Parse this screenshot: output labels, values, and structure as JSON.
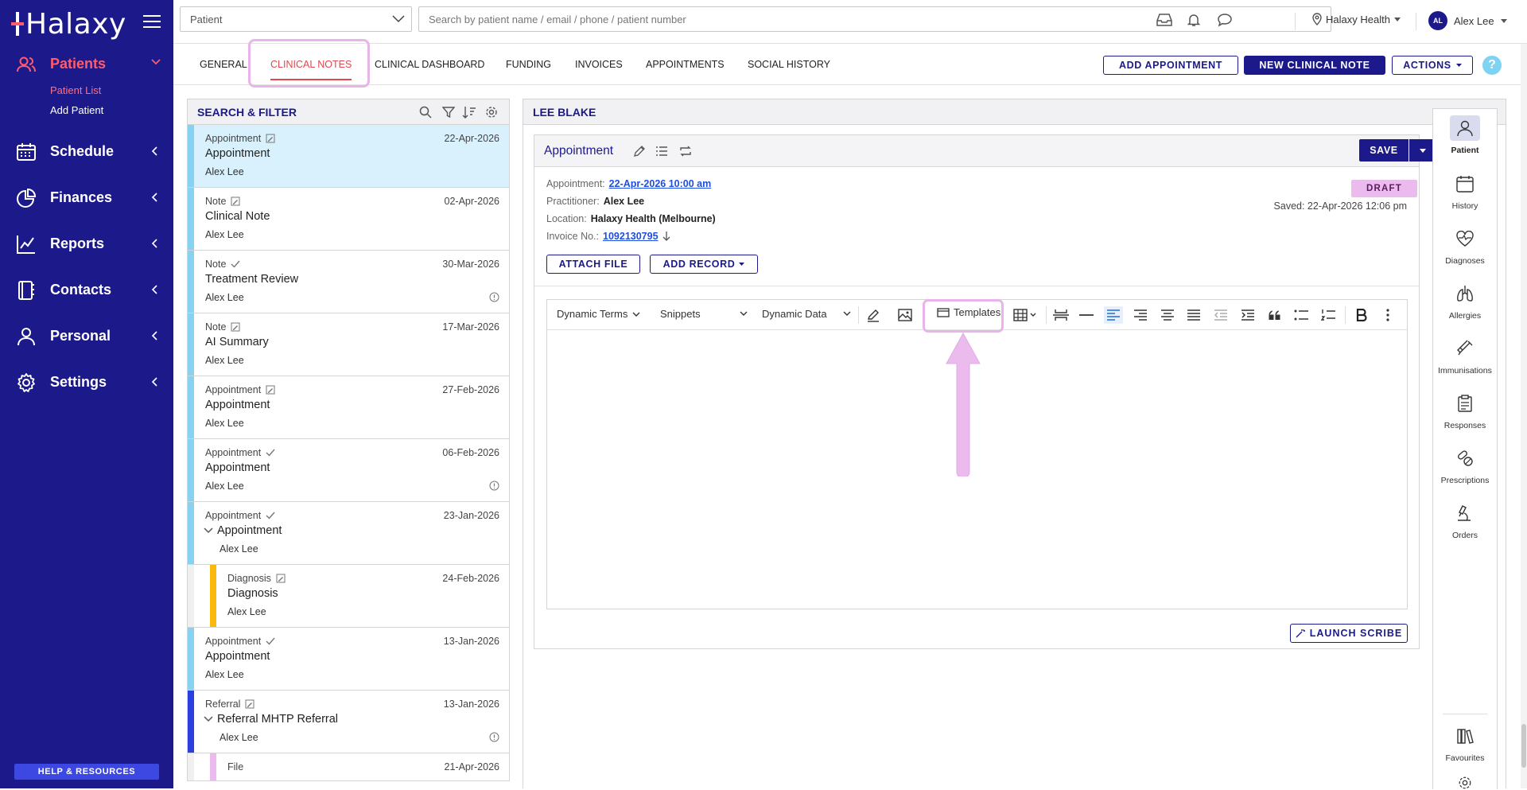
{
  "app": {
    "brand": "Halaxy",
    "accent": "#1c1a8a",
    "highlight": "#e0484e"
  },
  "sidebar": {
    "items": [
      {
        "label": "Patients",
        "icon": "users-icon"
      },
      {
        "label": "Schedule",
        "icon": "calendar-icon"
      },
      {
        "label": "Finances",
        "icon": "pie-chart-icon"
      },
      {
        "label": "Reports",
        "icon": "line-chart-icon"
      },
      {
        "label": "Contacts",
        "icon": "contacts-book-icon"
      },
      {
        "label": "Personal",
        "icon": "person-icon"
      },
      {
        "label": "Settings",
        "icon": "gear-icon"
      }
    ],
    "patient_sub": {
      "list": "Patient List",
      "add": "Add Patient"
    },
    "help": "HELP & RESOURCES"
  },
  "topbar": {
    "patient_select": "Patient",
    "search_placeholder": "Search by patient name / email / phone / patient number",
    "location": "Halaxy Health",
    "user_initials": "AL",
    "user_name": "Alex Lee"
  },
  "tabs": [
    "GENERAL",
    "CLINICAL NOTES",
    "CLINICAL DASHBOARD",
    "FUNDING",
    "INVOICES",
    "APPOINTMENTS",
    "SOCIAL HISTORY"
  ],
  "actions": {
    "add_appointment": "ADD APPOINTMENT",
    "new_clinical_note": "NEW CLINICAL NOTE",
    "actions": "ACTIONS",
    "help": "?"
  },
  "list": {
    "title": "SEARCH & FILTER",
    "notes": [
      {
        "type": "Appointment",
        "date": "22-Apr-2026",
        "title": "Appointment",
        "author": "Alex Lee"
      },
      {
        "type": "Note",
        "date": "02-Apr-2026",
        "title": "Clinical Note",
        "author": "Alex Lee"
      },
      {
        "type": "Note",
        "date": "30-Mar-2026",
        "title": "Treatment Review",
        "author": "Alex Lee"
      },
      {
        "type": "Note",
        "date": "17-Mar-2026",
        "title": "AI Summary",
        "author": "Alex Lee"
      },
      {
        "type": "Appointment",
        "date": "27-Feb-2026",
        "title": "Appointment",
        "author": "Alex Lee"
      },
      {
        "type": "Appointment",
        "date": "06-Feb-2026",
        "title": "Appointment",
        "author": "Alex Lee"
      },
      {
        "type": "Appointment",
        "date": "23-Jan-2026",
        "title": "Appointment",
        "author": "Alex Lee"
      },
      {
        "type": "Diagnosis",
        "date": "24-Feb-2026",
        "title": "Diagnosis",
        "author": "Alex Lee"
      },
      {
        "type": "Appointment",
        "date": "13-Jan-2026",
        "title": "Appointment",
        "author": "Alex Lee"
      },
      {
        "type": "Referral",
        "date": "13-Jan-2026",
        "title": "Referral MHTP Referral",
        "author": "Alex Lee"
      },
      {
        "type": "File",
        "date": "21-Apr-2026",
        "title": "",
        "author": ""
      }
    ]
  },
  "detail": {
    "patient_name": "LEE BLAKE",
    "card_title": "Appointment",
    "save": "SAVE",
    "status": "DRAFT",
    "saved": "Saved: 22-Apr-2026 12:06 pm",
    "appointment_label": "Appointment:",
    "appointment_value": "22-Apr-2026 10:00 am",
    "practitioner_label": "Practitioner:",
    "practitioner_value": "Alex Lee",
    "location_label": "Location:",
    "location_value": "Halaxy Health (Melbourne)",
    "invoice_label": "Invoice No.:",
    "invoice_value": "1092130795",
    "attach_file": "ATTACH FILE",
    "add_record": "ADD RECORD",
    "launch_scribe": "LAUNCH SCRIBE"
  },
  "toolbar": {
    "dynamic_terms": "Dynamic Terms",
    "snippets": "Snippets",
    "dynamic_data": "Dynamic Data",
    "templates": "Templates"
  },
  "rightbar": [
    "Patient",
    "History",
    "Diagnoses",
    "Allergies",
    "Immunisations",
    "Responses",
    "Prescriptions",
    "Orders",
    "Favourites"
  ]
}
